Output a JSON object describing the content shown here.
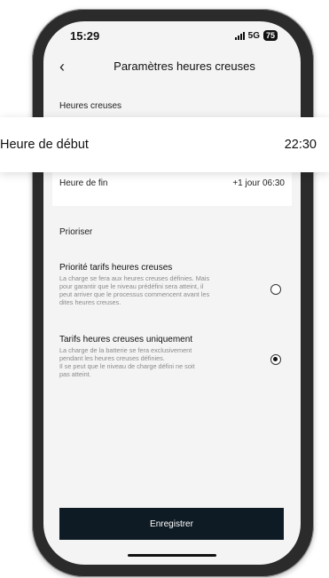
{
  "status_bar": {
    "time": "15:29",
    "network": "5G",
    "battery": "75"
  },
  "nav": {
    "back_icon": "‹",
    "title": "Paramètres heures creuses"
  },
  "off_peak": {
    "section_label": "Heures creuses",
    "start": {
      "label": "Heure de début",
      "value": "22:30"
    },
    "end": {
      "label": "Heure de fin",
      "value": "+1 jour 06:30"
    }
  },
  "prioritize": {
    "section_label": "Prioriser",
    "options": [
      {
        "title": "Priorité tarifs heures creuses",
        "description_lines": [
          "La charge se fera aux heures creuses définies. Mais",
          "pour garantir que le niveau prédéfini sera atteint, il",
          "peut arriver que le processus commencent avant les",
          "dites heures creuses."
        ],
        "selected": false
      },
      {
        "title": "Tarifs heures creuses uniquement",
        "description_lines": [
          "La charge de la batterie se fera exclusivement",
          "pendant les heures creuses définies.",
          "Il se peut que le niveau de charge défini ne soit",
          "pas atteint."
        ],
        "selected": true
      }
    ]
  },
  "save_label": "Enregistrer"
}
